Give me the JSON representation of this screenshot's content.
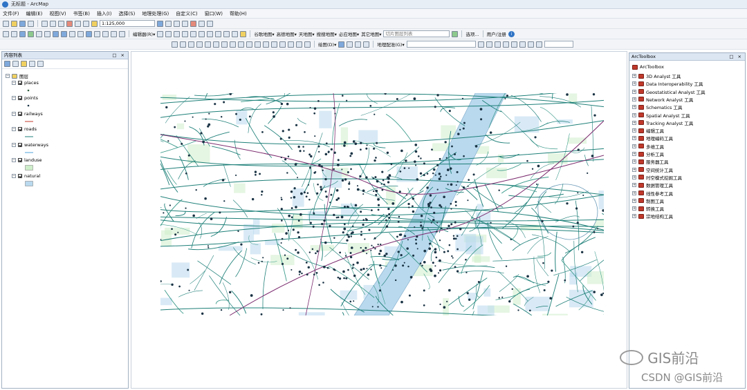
{
  "window": {
    "title": "无标题 - ArcMap"
  },
  "menu": [
    "文件(F)",
    "编辑(E)",
    "视图(V)",
    "书签(B)",
    "插入(I)",
    "选择(S)",
    "地理处理(G)",
    "自定义(C)",
    "窗口(W)",
    "帮助(H)"
  ],
  "toolbar1": {
    "scale": "1:125,000"
  },
  "toolbar2": {
    "editor": "编辑器(R)▾",
    "basemaps": [
      "谷歌地图▾",
      "高德地图▾",
      "天地图▾",
      "搜搜地图▾",
      "必应地图▾",
      "其它地图▾"
    ],
    "tile_list": "切片图层列表",
    "options": "选项...",
    "user": "用户/注册"
  },
  "toolbar3": {
    "draw": "绘图(D)▾",
    "georef": "地理配准(G)▾"
  },
  "toc": {
    "title": "内容列表",
    "root": "图层",
    "layers": [
      {
        "name": "places",
        "symbol": "point",
        "color": "#2e5e3e"
      },
      {
        "name": "points",
        "symbol": "point",
        "color": "#1a3344"
      },
      {
        "name": "railways",
        "symbol": "line",
        "color": "#c0392b"
      },
      {
        "name": "roads",
        "symbol": "line",
        "color": "#1d7f78"
      },
      {
        "name": "waterways",
        "symbol": "line",
        "color": "#4fa0d8"
      },
      {
        "name": "landuse",
        "symbol": "fill",
        "color": "#cfeecb"
      },
      {
        "name": "natural",
        "symbol": "fill",
        "color": "#b9d9ee"
      }
    ]
  },
  "toolbox": {
    "title": "ArcToolbox",
    "root": "ArcToolbox",
    "items": [
      "3D Analyst 工具",
      "Data Interoperability 工具",
      "Geostatistical Analyst 工具",
      "Network Analyst 工具",
      "Schematics 工具",
      "Spatial Analyst 工具",
      "Tracking Analyst 工具",
      "编辑工具",
      "地理编码工具",
      "多维工具",
      "分析工具",
      "服务器工具",
      "空间统计工具",
      "时空模式挖掘工具",
      "数据管理工具",
      "线性参考工具",
      "制图工具",
      "转换工具",
      "宗地结构工具"
    ]
  },
  "watermark": {
    "wechat": "GIS前沿",
    "csdn": "CSDN @GIS前沿"
  },
  "colors": {
    "road": "#1d7f78",
    "water": "#b9d9ee",
    "points": "#1a3344",
    "land": "#cfeecb",
    "rail": "#7b2a6e"
  }
}
